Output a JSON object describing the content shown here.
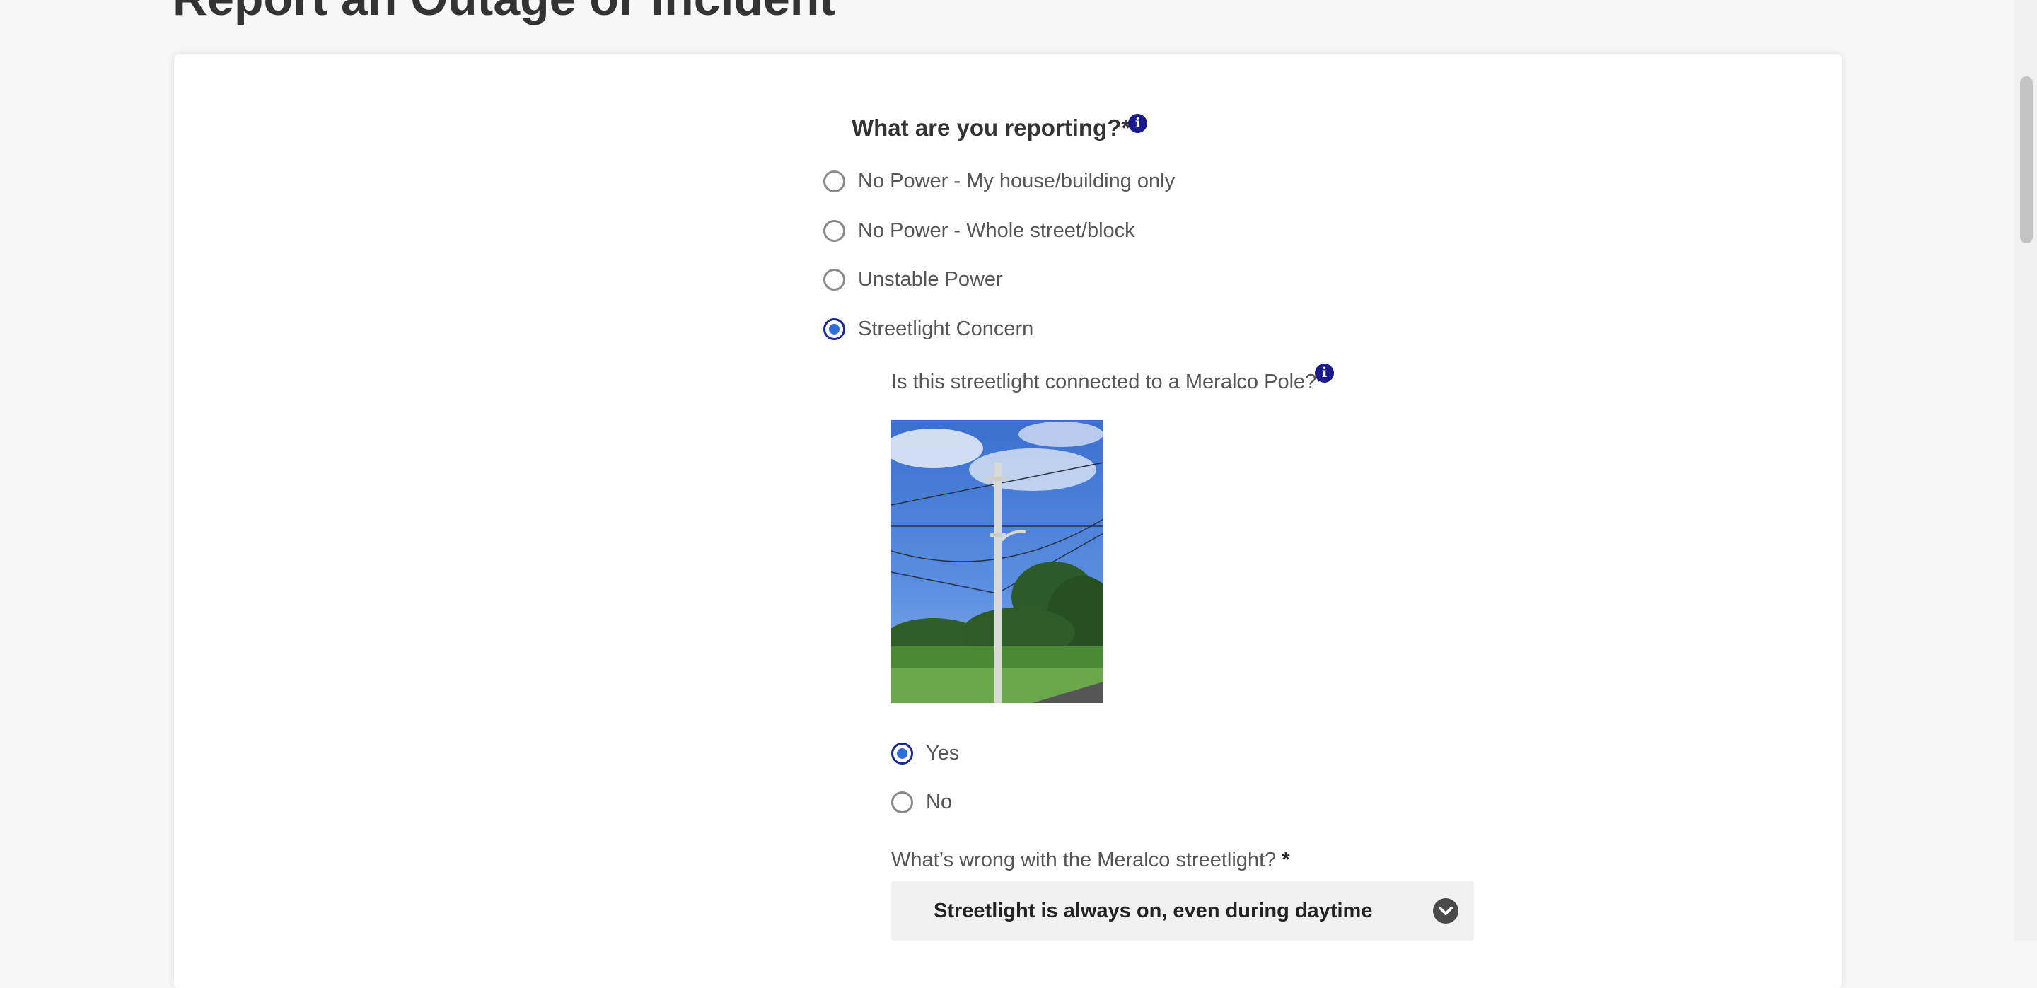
{
  "page": {
    "title": "Report an Outage or Incident"
  },
  "reporting": {
    "question": "What are you reporting?",
    "required_mark": "*",
    "info_icon": "info-icon",
    "options": [
      {
        "label": "No Power - My house/building only",
        "selected": false
      },
      {
        "label": "No Power - Whole street/block",
        "selected": false
      },
      {
        "label": "Unstable Power",
        "selected": false
      },
      {
        "label": "Streetlight Concern",
        "selected": true
      }
    ]
  },
  "meralco_pole": {
    "question": "Is this streetlight connected to a Meralco Pole?",
    "required_mark": "*",
    "info_icon": "info-icon",
    "options": [
      {
        "label": "Yes",
        "selected": true
      },
      {
        "label": "No",
        "selected": false
      }
    ]
  },
  "streetlight_issue": {
    "question": "What’s wrong with the Meralco streetlight?",
    "required_mark": "*",
    "selected_value": "Streetlight is always on, even during daytime",
    "chevron_icon": "chevron-down-icon"
  },
  "colors": {
    "accent": "#1a1a8c",
    "radio_fill": "#2f6fd6",
    "background": "#f7f7f7",
    "card": "#ffffff"
  }
}
